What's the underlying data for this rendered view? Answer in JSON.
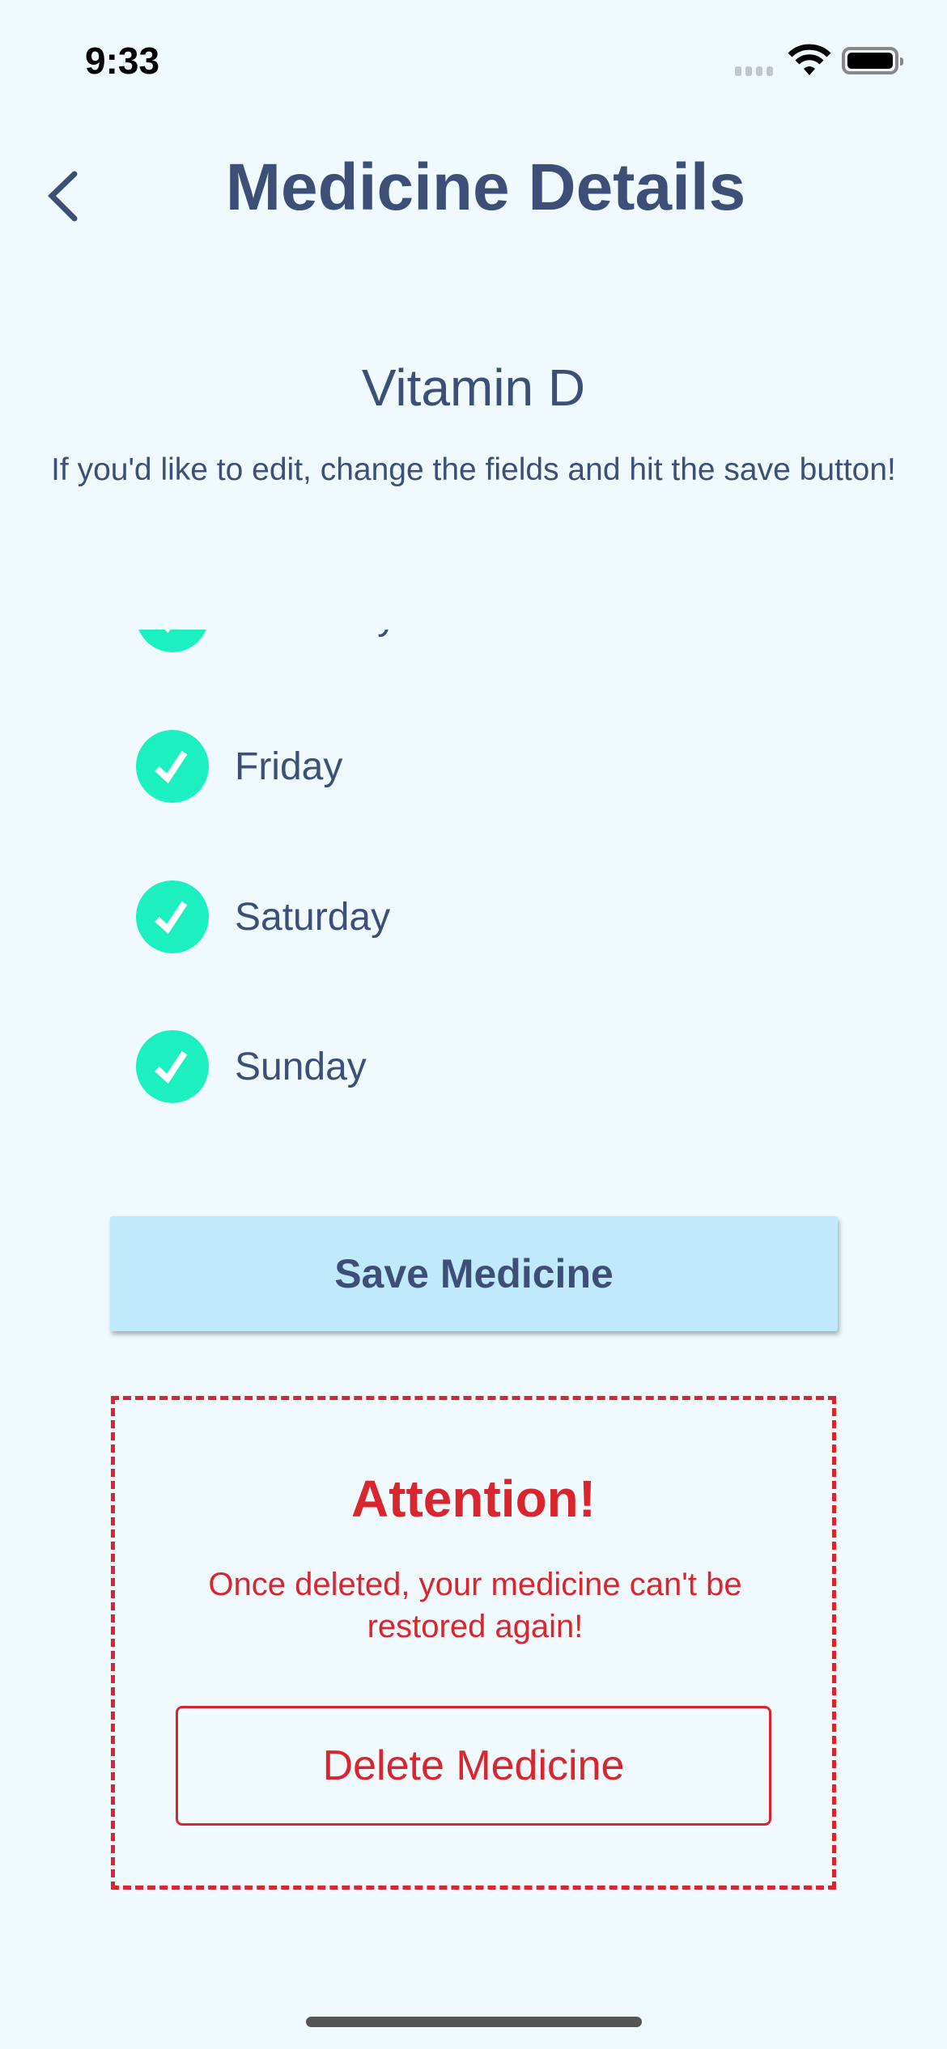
{
  "status_bar": {
    "time": "9:33"
  },
  "header": {
    "title": "Medicine Details"
  },
  "medicine": {
    "name": "Vitamin D",
    "instructions": "If you'd like to edit, change the fields and hit the save button!"
  },
  "days": [
    {
      "label": "Thursday",
      "checked": true
    },
    {
      "label": "Friday",
      "checked": true
    },
    {
      "label": "Saturday",
      "checked": true
    },
    {
      "label": "Sunday",
      "checked": true
    }
  ],
  "actions": {
    "save_label": "Save Medicine"
  },
  "warning": {
    "title": "Attention!",
    "message": "Once deleted, your medicine can't be restored again!",
    "delete_label": "Delete Medicine"
  },
  "colors": {
    "primary": "#3d4f77",
    "accent": "#1df0c0",
    "danger": "#d9262e",
    "save_bg": "#c0e9fb",
    "background": "#eff9fe"
  }
}
